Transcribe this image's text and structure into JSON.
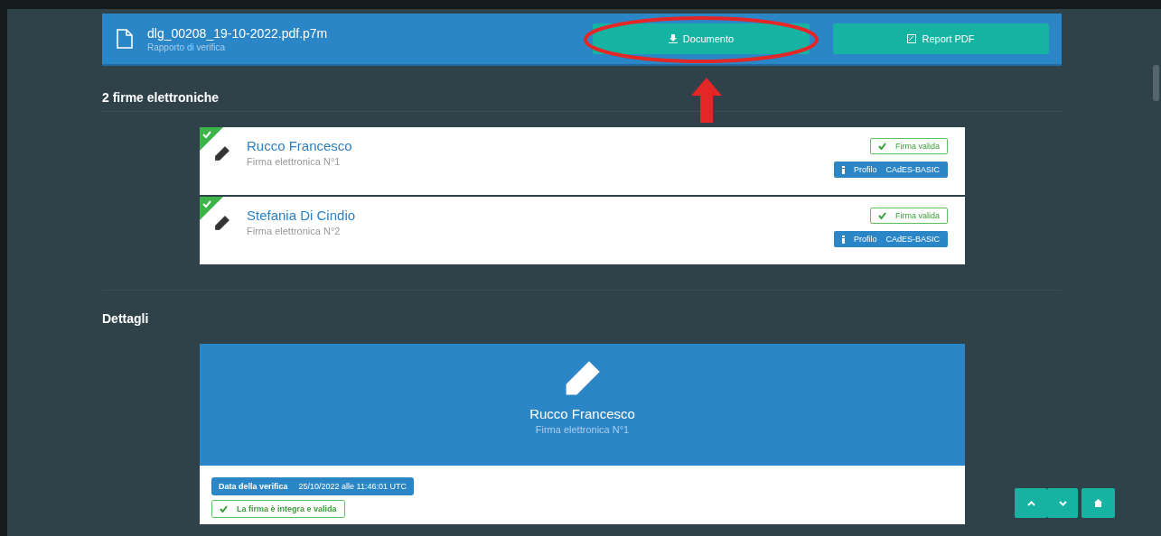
{
  "file": {
    "name": "dlg_00208_19-10-2022.pdf.p7m",
    "subtitle": "Rapporto di verifica"
  },
  "buttons": [
    {
      "label": "Documento",
      "kind": "download"
    },
    {
      "label": "Report PDF",
      "kind": "report"
    }
  ],
  "signatures_heading": "2 firme elettroniche",
  "signatures": [
    {
      "name": "Rucco Francesco",
      "subtitle": "Firma elettronica N°1",
      "valid": true,
      "status": "Firma valida",
      "profile_label": "Profilo",
      "profile": "CAdES-BASIC"
    },
    {
      "name": "Stefania Di Cindio",
      "subtitle": "Firma elettronica N°2",
      "valid": true,
      "status": "Firma valida",
      "profile_label": "Profilo",
      "profile": "CAdES-BASIC"
    }
  ],
  "details": {
    "heading": "Dettagli",
    "name": "Rucco Francesco",
    "subtitle": "Firma elettronica N°1",
    "date_label": "Data della verifica",
    "date": "25/10/2022 alle 11:46:01 UTC",
    "integrity": "La firma è integra e valida"
  }
}
